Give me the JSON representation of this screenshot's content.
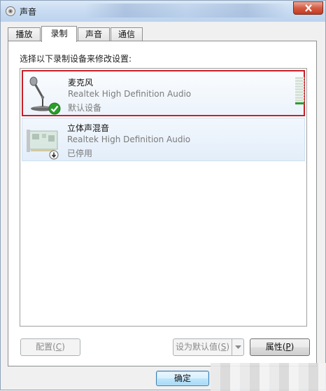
{
  "window": {
    "title": "声音"
  },
  "tabs": [
    {
      "label": "播放"
    },
    {
      "label": "录制"
    },
    {
      "label": "声音"
    },
    {
      "label": "通信"
    }
  ],
  "active_tab": "录制",
  "instruction": "选择以下录制设备来修改设置:",
  "devices": [
    {
      "name": "麦克风",
      "driver": "Realtek High Definition Audio",
      "status": "默认设备",
      "icon": "microphone-icon",
      "badge": "green-check-icon",
      "selected": true,
      "level": 0.1
    },
    {
      "name": "立体声混音",
      "driver": "Realtek High Definition Audio",
      "status": "已停用",
      "icon": "sound-card-icon",
      "badge": "down-arrow-badge-icon",
      "selected": false
    }
  ],
  "buttons": {
    "configure": {
      "text": "配置(",
      "key": "C",
      "end": ")"
    },
    "set_default": {
      "text": "设为默认值(",
      "key": "S",
      "end": ")"
    },
    "properties": {
      "text": "属性(",
      "key": "P",
      "end": ")"
    },
    "ok": "确定"
  },
  "colors": {
    "selection_border": "#c81f28",
    "level_on": "#2c9e2c",
    "check": "#2a9d2a"
  }
}
